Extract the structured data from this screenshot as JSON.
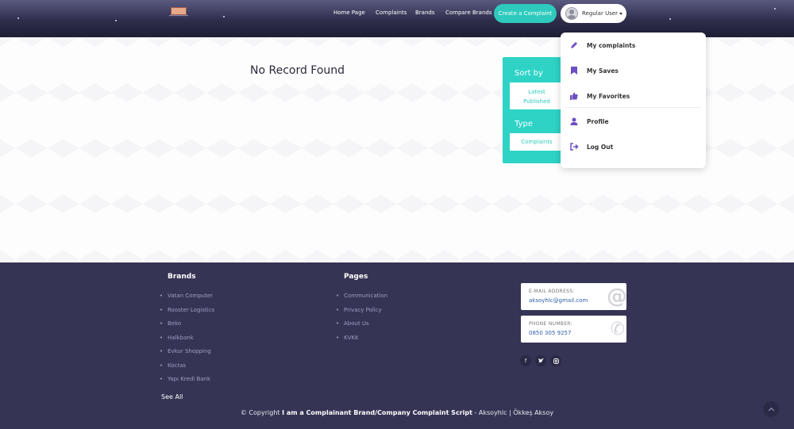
{
  "header": {
    "nav": [
      "Home Page",
      "Complaints",
      "Brands",
      "Compare Brands"
    ],
    "cta_label": "Create a Complaint",
    "user_label": "Regular User"
  },
  "main": {
    "empty_message": "No Record Found",
    "filters": {
      "sort_title": "Sort by",
      "sort_value_line1": "Latest",
      "sort_value_line2": "Published",
      "type_title": "Type",
      "type_value": "Complaints"
    }
  },
  "user_menu": {
    "items": [
      {
        "label": "My complaints",
        "icon": "pencil-icon"
      },
      {
        "label": "My Saves",
        "icon": "bookmark-icon"
      },
      {
        "label": "My Favorites",
        "icon": "thumbs-up-icon"
      },
      {
        "label": "Profile",
        "icon": "user-icon"
      },
      {
        "label": "Log Out",
        "icon": "logout-icon"
      }
    ]
  },
  "footer": {
    "brands_title": "Brands",
    "brands": [
      "Vatan Computer",
      "Rooster Logistics",
      "Beko",
      "Halkbank",
      "Evkur Shopping",
      "Koctas",
      "Yapı Kredi Bank"
    ],
    "see_all": "See All",
    "pages_title": "Pages",
    "pages": [
      "Communication",
      "Privacy Policy",
      "About Us",
      "KVKK"
    ],
    "email_label": "E-MAIL ADDRESS:",
    "email_value": "aksoyhlc@gmail.com",
    "phone_label": "PHONE NUMBER:",
    "phone_value": "0850 305 9257",
    "social": [
      "facebook-icon",
      "twitter-icon",
      "instagram-icon"
    ],
    "copyright_prefix": "© Copyright",
    "copyright_bold": "I am a Complainant Brand/Company Complaint Script",
    "copyright_suffix": "- Aksoyhlc | Ökkeş Aksoy"
  },
  "colors": {
    "accent": "#2dcabd",
    "header_dark": "#2e2d4b",
    "footer_bg": "#353454",
    "menu_icon": "#6c4fc2"
  }
}
